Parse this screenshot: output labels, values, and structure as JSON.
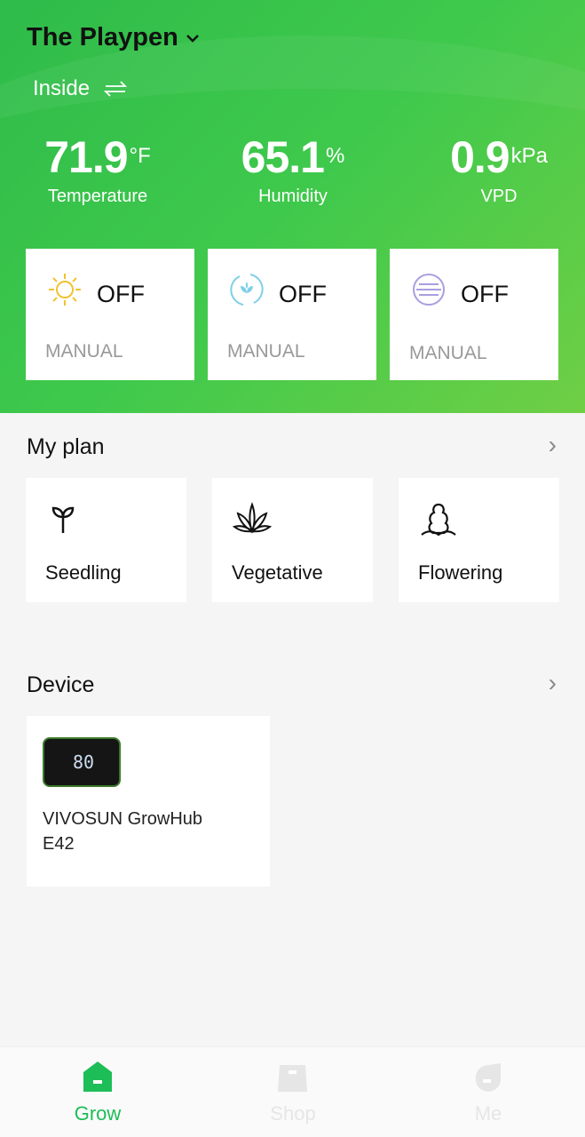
{
  "header": {
    "title": "The Playpen",
    "location": "Inside"
  },
  "metrics": [
    {
      "value": "71.9",
      "unit": "°F",
      "label": "Temperature"
    },
    {
      "value": "65.1",
      "unit": "%",
      "label": "Humidity"
    },
    {
      "value": "0.9",
      "unit": "kPa",
      "label": "VPD"
    }
  ],
  "controls": [
    {
      "icon": "sun-icon",
      "state": "OFF",
      "mode": "MANUAL",
      "color": "#f2c230"
    },
    {
      "icon": "plant-cycle-icon",
      "state": "OFF",
      "mode": "MANUAL",
      "color": "#7ecfe8"
    },
    {
      "icon": "fan-lines-icon",
      "state": "OFF",
      "mode": "MANUAL",
      "color": "#a99ee0"
    }
  ],
  "plan": {
    "title": "My plan",
    "items": [
      "Seedling",
      "Vegetative",
      "Flowering"
    ]
  },
  "device": {
    "title": "Device",
    "name": "VIVOSUN GrowHub E42",
    "screen_value": "80"
  },
  "nav": [
    {
      "label": "Grow",
      "active": true
    },
    {
      "label": "Shop"
    },
    {
      "label": "Me"
    }
  ],
  "colors": {
    "accent": "#1dbd57",
    "inactive": "#e6e6e6"
  }
}
